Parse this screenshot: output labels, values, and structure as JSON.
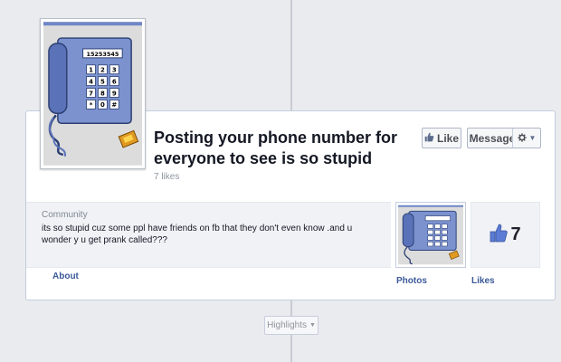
{
  "page": {
    "title": "Posting your phone number for everyone to see is so stupid",
    "likes_text": "7 likes"
  },
  "header": {
    "like_button": "Like",
    "message_button": "Message"
  },
  "about": {
    "category": "Community",
    "description": "its so stupid cuz some ppl have friends on fb that they don't even know .and u wonder y u get prank called???",
    "tab_label": "About"
  },
  "photos": {
    "tab_label": "Photos"
  },
  "likes": {
    "count": "7",
    "tab_label": "Likes"
  },
  "phone_display": "15253545",
  "keypad": [
    "1",
    "2",
    "3",
    "4",
    "5",
    "6",
    "7",
    "8",
    "9",
    "*",
    "0",
    "#"
  ],
  "timeline": {
    "highlights_label": "Highlights"
  },
  "icons": {
    "like": "thumbs-up-icon",
    "gear": "gear-icon",
    "dropdown": "chevron-down-icon",
    "profile": "telephone-illustration"
  },
  "colors": {
    "link": "#3b5998",
    "background": "#e9ebee",
    "phone_body": "#6f86c6",
    "thumb": "#5b7bd5"
  }
}
